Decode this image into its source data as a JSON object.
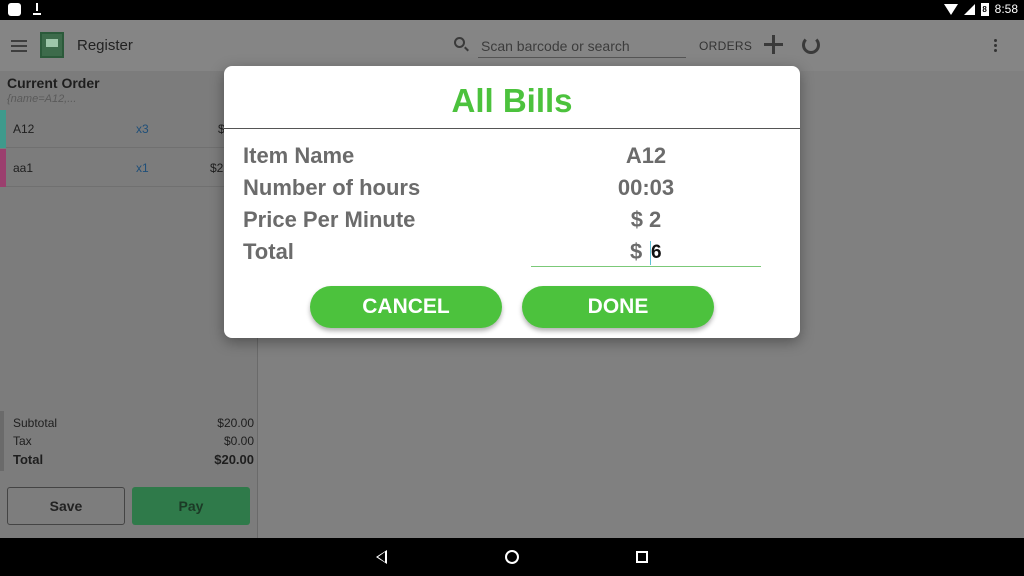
{
  "status_bar": {
    "time": "8:58",
    "battery": "8"
  },
  "toolbar": {
    "title": "Register",
    "search_placeholder": "Scan barcode or search",
    "orders_label": "ORDERS"
  },
  "order": {
    "heading": "Current Order",
    "query": "{name=A12,...",
    "items": [
      {
        "name": "A12",
        "qty": "x3",
        "price": "$",
        "color": "#3f9a8c"
      },
      {
        "name": "aa1",
        "qty": "x1",
        "price": "$2",
        "color": "#9b3f6e"
      }
    ],
    "subtotal_label": "Subtotal",
    "subtotal_value": "$20.00",
    "tax_label": "Tax",
    "tax_value": "$0.00",
    "total_label": "Total",
    "total_value": "$20.00",
    "save_label": "Save",
    "pay_label": "Pay"
  },
  "dialog": {
    "title": "All Bills",
    "rows": [
      {
        "label": "Item Name",
        "value": "A12"
      },
      {
        "label": "Number of hours",
        "value": "00:03"
      },
      {
        "label": "Price Per Minute",
        "value": "$ 2"
      }
    ],
    "total_label": "Total",
    "total_currency": "$",
    "total_value": "6",
    "cancel_label": "CANCEL",
    "done_label": "DONE"
  },
  "colors": {
    "accent_green": "#4cc23d",
    "label_gray": "#6b6b6b"
  }
}
